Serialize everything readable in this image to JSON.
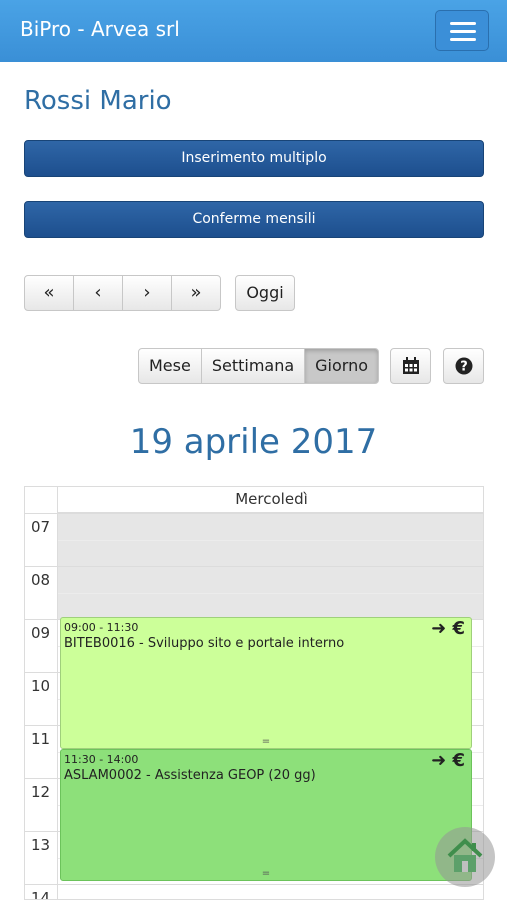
{
  "header": {
    "brand": "BiPro - Arvea srl",
    "menu_icon": "hamburger-icon"
  },
  "user_name": "Rossi Mario",
  "actions": {
    "multi_insert": "Inserimento multiplo",
    "monthly_confirm": "Conferme mensili"
  },
  "nav": {
    "first": "«",
    "prev": "‹",
    "next": "›",
    "last": "»",
    "today": "Oggi"
  },
  "views": {
    "month": "Mese",
    "week": "Settimana",
    "day": "Giorno",
    "active": "Giorno"
  },
  "tools": {
    "calendar_icon": "calendar-icon",
    "help_icon": "help-icon"
  },
  "calendar": {
    "date_title": "19 aprile 2017",
    "day_header": "Mercoledì",
    "hours": [
      "07",
      "08",
      "09",
      "10",
      "11",
      "12",
      "13",
      "14"
    ],
    "events": [
      {
        "time": "09:00 - 11:30",
        "title": "BITEB0016 - Sviluppo sito e portale interno",
        "color": "#ccff99",
        "icons": "➜ €"
      },
      {
        "time": "11:30 - 14:00",
        "title": "ASLAM0002 - Assistenza GEOP (20 gg)",
        "color": "#8de07a",
        "icons": "➜ €"
      }
    ]
  },
  "colors": {
    "navbar": "#3a8fd6",
    "primary_button": "#2a5f9e",
    "title": "#2f6ea4"
  },
  "home_icon": "home-icon"
}
